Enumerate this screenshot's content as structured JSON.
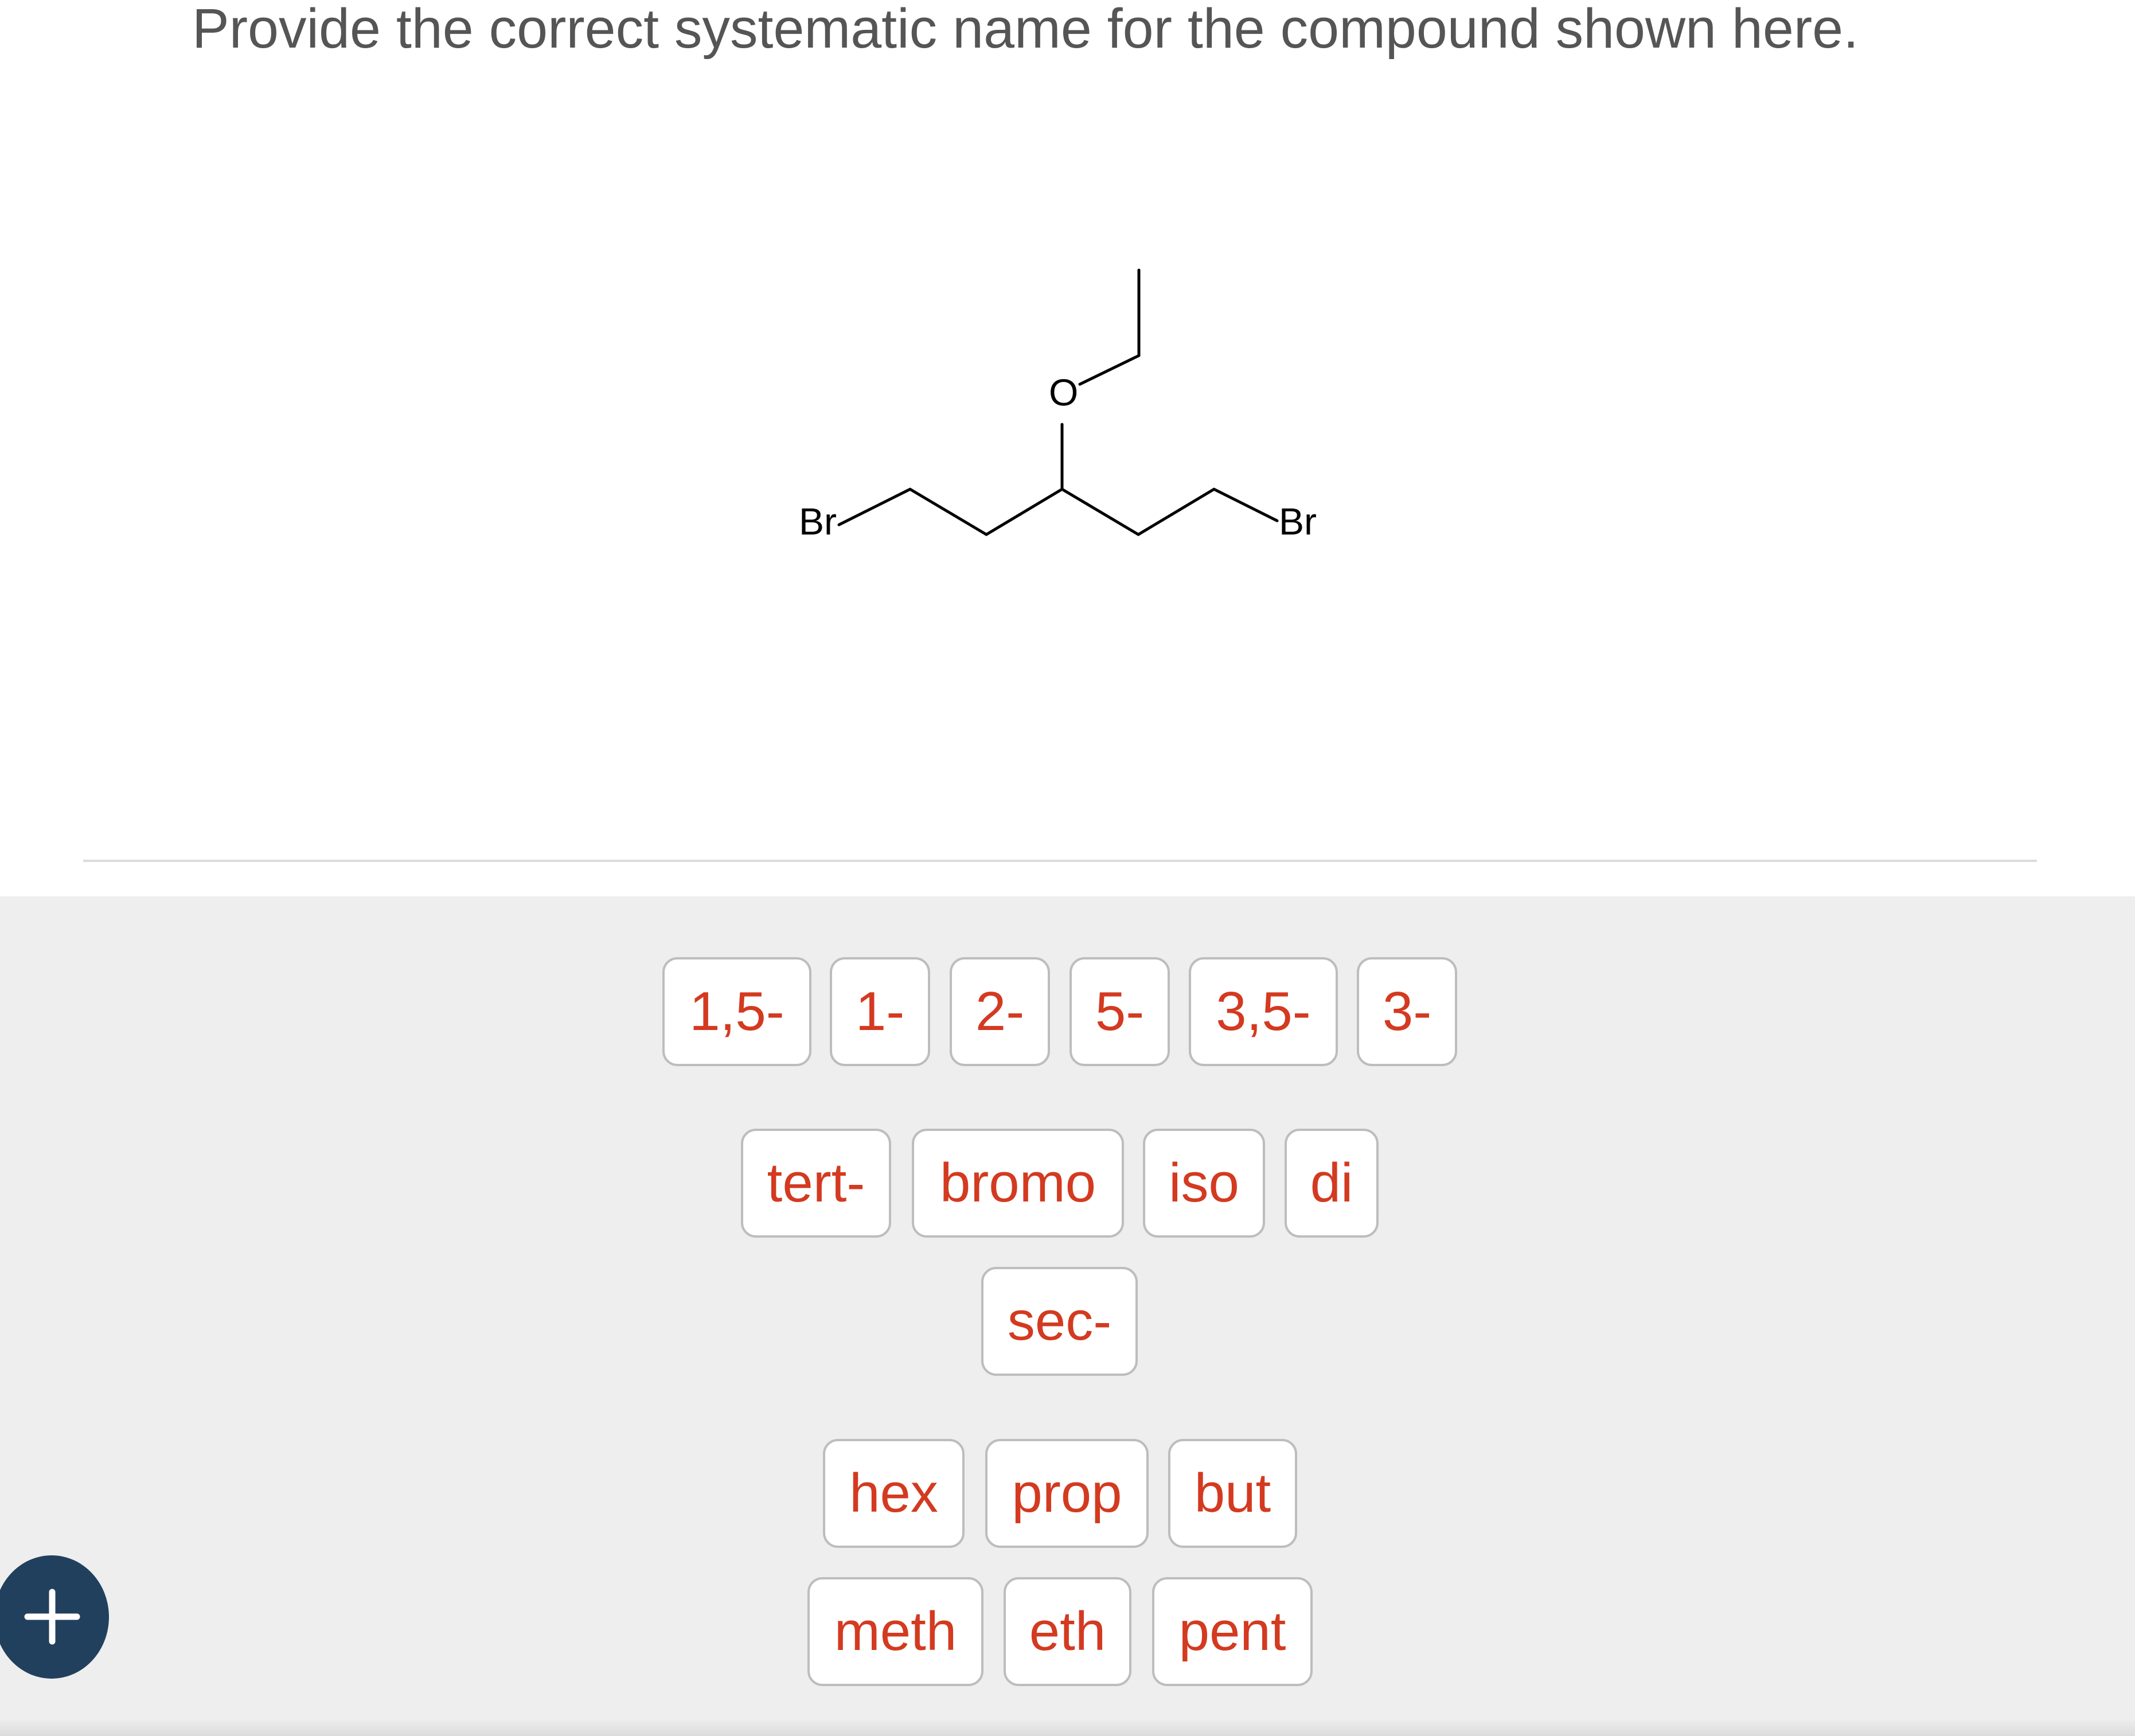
{
  "question": {
    "text": "Provide the correct systematic name for the compound shown here."
  },
  "structure": {
    "atoms": {
      "left_halogen": "Br",
      "right_halogen": "Br",
      "ether_oxygen": "O"
    }
  },
  "tiles": {
    "row1": [
      "1,5-",
      "1-",
      "2-",
      "5-",
      "3,5-",
      "3-"
    ],
    "row2": [
      "tert-",
      "bromo",
      "iso",
      "di"
    ],
    "row3": [
      "sec-"
    ],
    "row4": [
      "hex",
      "prop",
      "but"
    ],
    "row5": [
      "meth",
      "eth",
      "pent"
    ]
  },
  "add_button": {
    "icon": "plus-icon"
  },
  "colors": {
    "tile_text": "#d33a20",
    "tile_border": "#bdbdbd",
    "tray_background": "#eeeeee",
    "question_text": "#555555",
    "add_button": "#21405e"
  }
}
